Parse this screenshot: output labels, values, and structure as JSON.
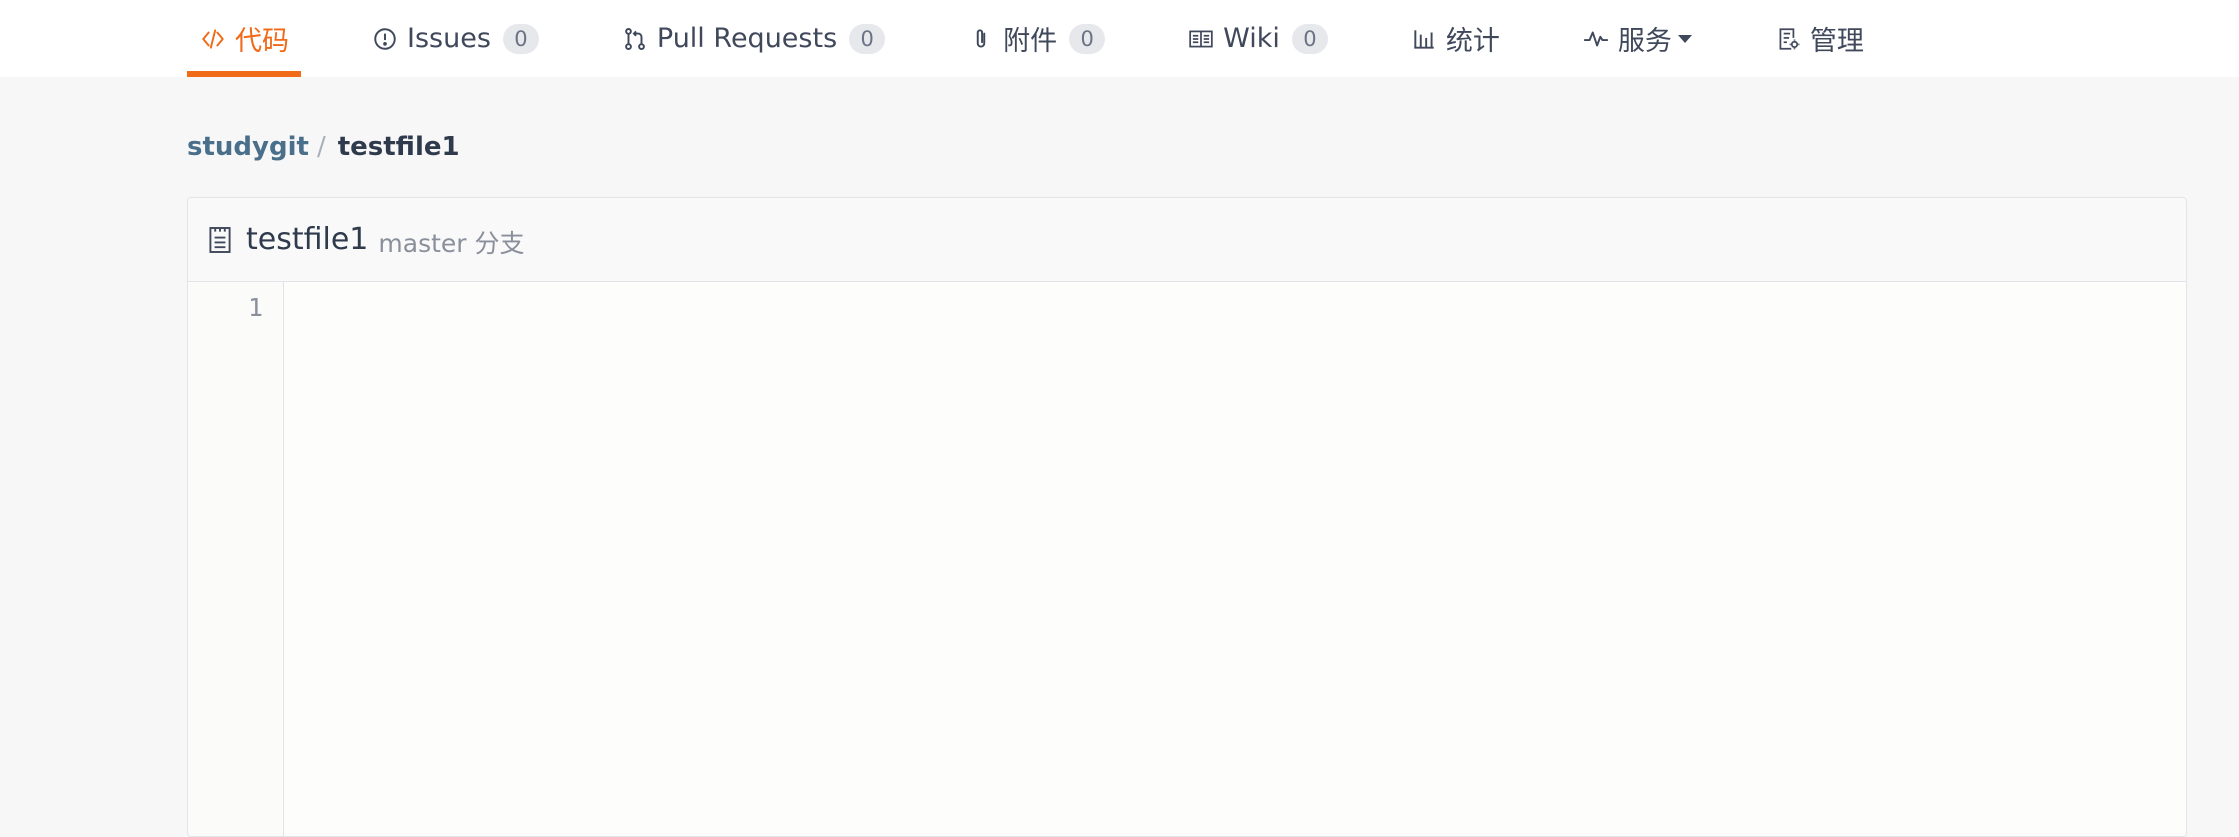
{
  "nav": {
    "tabs": [
      {
        "label": "代码",
        "icon": "code-icon",
        "active": true
      },
      {
        "label": "Issues",
        "icon": "issue-icon",
        "count": "0"
      },
      {
        "label": "Pull Requests",
        "icon": "pull-request-icon",
        "count": "0"
      },
      {
        "label": "附件",
        "icon": "paperclip-icon",
        "count": "0"
      },
      {
        "label": "Wiki",
        "icon": "book-icon",
        "count": "0"
      },
      {
        "label": "统计",
        "icon": "bar-chart-icon"
      },
      {
        "label": "服务",
        "icon": "pulse-icon",
        "dropdown": true
      },
      {
        "label": "管理",
        "icon": "settings-doc-icon"
      }
    ],
    "accent_color": "#f06a17"
  },
  "breadcrumb": {
    "repo": "studygit",
    "separator": "/",
    "file": "testfile1"
  },
  "file": {
    "name": "testfile1",
    "branch": "master 分支",
    "icon": "file-icon",
    "line_numbers": [
      "1"
    ]
  }
}
